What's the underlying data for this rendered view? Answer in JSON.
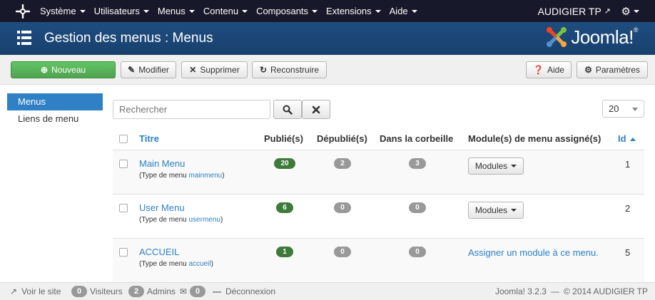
{
  "nav": {
    "items": [
      "Système",
      "Utilisateurs",
      "Menus",
      "Contenu",
      "Composants",
      "Extensions",
      "Aide"
    ],
    "site_name": "AUDIGIER TP"
  },
  "header": {
    "title": "Gestion des menus : Menus",
    "logo_text": "Joomla!",
    "logo_reg": "®"
  },
  "toolbar": {
    "new": "Nouveau",
    "edit": "Modifier",
    "delete": "Supprimer",
    "rebuild": "Reconstruire",
    "help": "Aide",
    "options": "Paramètres"
  },
  "sidebar": {
    "items": [
      {
        "label": "Menus"
      },
      {
        "label": "Liens de menu"
      }
    ]
  },
  "search": {
    "placeholder": "Rechercher"
  },
  "limit": {
    "value": "20"
  },
  "table": {
    "headers": {
      "title": "Titre",
      "published": "Publié(s)",
      "unpublished": "Dépublié(s)",
      "trashed": "Dans la corbeille",
      "modules": "Module(s) de menu assigné(s)",
      "id": "Id"
    },
    "type_prefix": "(Type de menu",
    "type_suffix": ")",
    "modules_button": "Modules",
    "rows": [
      {
        "title": "Main Menu",
        "menutype": "mainmenu",
        "published": "20",
        "unpublished": "2",
        "trashed": "3",
        "modules": "button",
        "id": "1"
      },
      {
        "title": "User Menu",
        "menutype": "usermenu",
        "published": "6",
        "unpublished": "0",
        "trashed": "0",
        "modules": "button",
        "id": "2"
      },
      {
        "title": "ACCUEIL",
        "menutype": "accueil",
        "published": "1",
        "unpublished": "0",
        "trashed": "0",
        "modules": "Assigner un module à ce menu.",
        "id": "5"
      }
    ]
  },
  "footer": {
    "view_site": "Voir le site",
    "visitors_count": "0",
    "visitors_label": "Visiteurs",
    "admins_count": "2",
    "admins_label": "Admins",
    "messages_count": "0",
    "logout": "Déconnexion",
    "version": "Joomla! 3.2.3",
    "separator": "—",
    "copyright": "© 2014 AUDIGIER TP"
  },
  "colors": {
    "nav_bg": "#17192a",
    "header_bg": "#1f4d80",
    "link": "#2f80c4",
    "success": "#51a351",
    "badge_green": "#3e7a3a",
    "badge_grey": "#999999"
  }
}
